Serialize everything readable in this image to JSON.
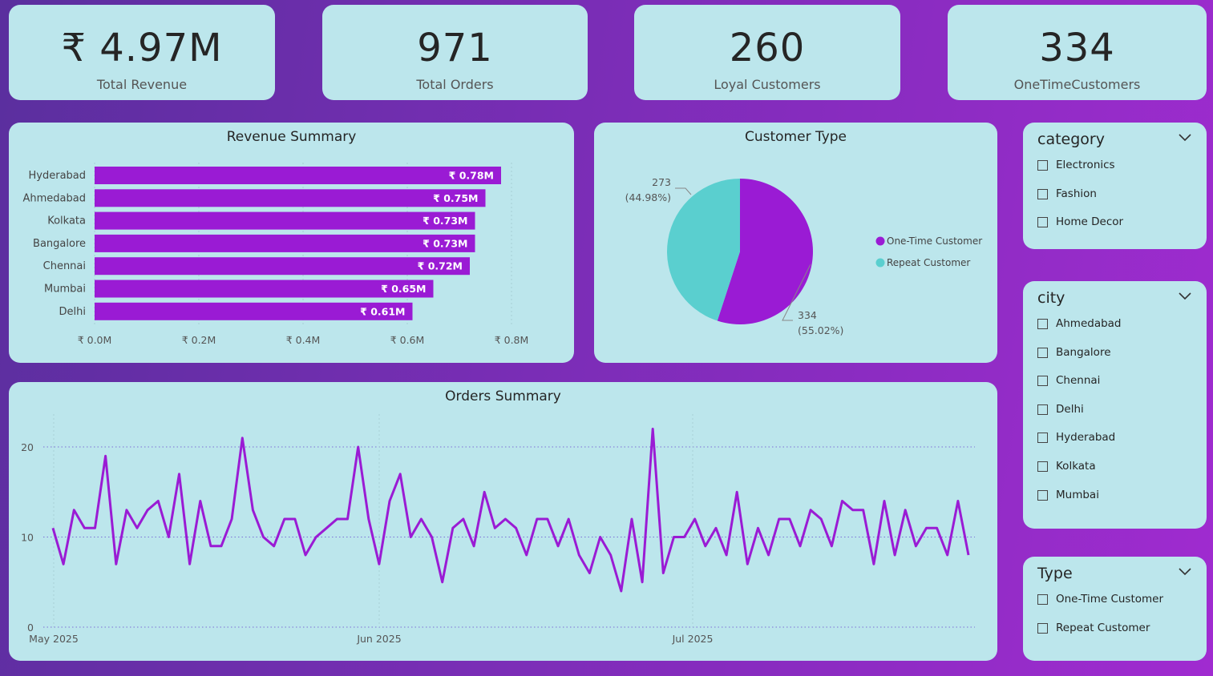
{
  "kpis": [
    {
      "value": "₹ 4.97M",
      "label": "Total Revenue"
    },
    {
      "value": "971",
      "label": "Total Orders"
    },
    {
      "value": "260",
      "label": "Loyal Customers"
    },
    {
      "value": "334",
      "label": "OneTimeCustomers"
    }
  ],
  "revenue_summary": {
    "title": "Revenue Summary"
  },
  "customer_type": {
    "title": "Customer Type",
    "slice_labels": [
      {
        "line1": "334",
        "line2": "(55.02%)"
      },
      {
        "line1": "273",
        "line2": "(44.98%)"
      }
    ]
  },
  "orders_summary": {
    "title": "Orders Summary"
  },
  "slicers": {
    "category": {
      "title": "category",
      "options": [
        "Electronics",
        "Fashion",
        "Home Decor"
      ]
    },
    "city": {
      "title": "city",
      "options": [
        "Ahmedabad",
        "Bangalore",
        "Chennai",
        "Delhi",
        "Hyderabad",
        "Kolkata",
        "Mumbai"
      ]
    },
    "type": {
      "title": "Type",
      "options": [
        "One-Time Customer",
        "Repeat Customer"
      ]
    }
  },
  "colors": {
    "purple": "#9a1bd4",
    "teal": "#5acfcf",
    "card": "#bce6ec"
  },
  "chart_data": [
    {
      "type": "bar",
      "orientation": "horizontal",
      "title": "Revenue Summary",
      "categories": [
        "Hyderabad",
        "Ahmedabad",
        "Kolkata",
        "Bangalore",
        "Chennai",
        "Mumbai",
        "Delhi"
      ],
      "values": [
        0.78,
        0.75,
        0.73,
        0.73,
        0.72,
        0.65,
        0.61
      ],
      "value_labels": [
        "₹ 0.78M",
        "₹ 0.75M",
        "₹ 0.73M",
        "₹ 0.73M",
        "₹ 0.72M",
        "₹ 0.65M",
        "₹ 0.61M"
      ],
      "xticks": [
        "₹ 0.0M",
        "₹ 0.2M",
        "₹ 0.4M",
        "₹ 0.6M",
        "₹ 0.8M"
      ],
      "xlim": [
        0,
        0.8
      ],
      "color": "#9a1bd4"
    },
    {
      "type": "pie",
      "title": "Customer Type",
      "labels": [
        "One-Time Customer",
        "Repeat Customer"
      ],
      "values": [
        334,
        273
      ],
      "percents": [
        55.02,
        44.98
      ],
      "colors": [
        "#9a1bd4",
        "#5acfcf"
      ],
      "legend": "right"
    },
    {
      "type": "line",
      "title": "Orders Summary",
      "x_start": "2025-05-01",
      "values": [
        11,
        7,
        13,
        11,
        11,
        19,
        7,
        13,
        11,
        13,
        14,
        10,
        17,
        7,
        14,
        9,
        9,
        12,
        21,
        13,
        10,
        9,
        12,
        12,
        8,
        10,
        11,
        12,
        12,
        20,
        12,
        7,
        14,
        17,
        10,
        12,
        10,
        5,
        11,
        12,
        9,
        15,
        11,
        12,
        11,
        8,
        12,
        12,
        9,
        12,
        8,
        6,
        10,
        8,
        4,
        12,
        5,
        22,
        6,
        10,
        10,
        12,
        9,
        11,
        8,
        15,
        7,
        11,
        8,
        12,
        12,
        9,
        13,
        12,
        9,
        14,
        13,
        13,
        7,
        14,
        8,
        13,
        9,
        11,
        11,
        8,
        14,
        8
      ],
      "xticks": [
        "May 2025",
        "Jun 2025",
        "Jul 2025"
      ],
      "yticks": [
        "0",
        "10",
        "20"
      ],
      "ylim": [
        0,
        24
      ],
      "grid": true,
      "color": "#9a1bd4"
    }
  ]
}
